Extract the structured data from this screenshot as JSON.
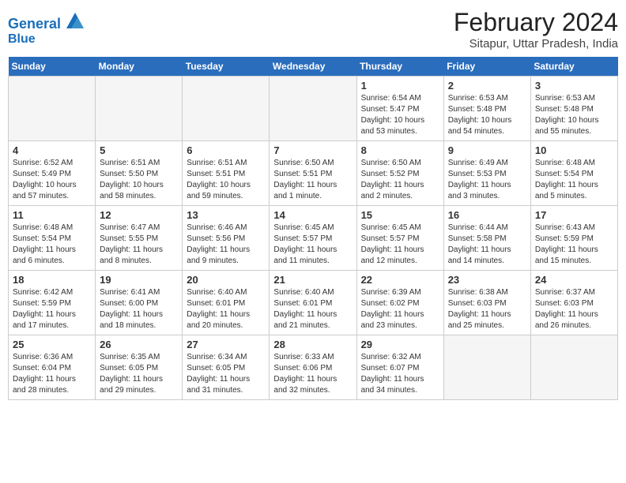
{
  "header": {
    "logo_line1": "General",
    "logo_line2": "Blue",
    "title": "February 2024",
    "subtitle": "Sitapur, Uttar Pradesh, India"
  },
  "days_of_week": [
    "Sunday",
    "Monday",
    "Tuesday",
    "Wednesday",
    "Thursday",
    "Friday",
    "Saturday"
  ],
  "weeks": [
    [
      {
        "day": "",
        "empty": true
      },
      {
        "day": "",
        "empty": true
      },
      {
        "day": "",
        "empty": true
      },
      {
        "day": "",
        "empty": true
      },
      {
        "day": "1",
        "sunrise": "6:54 AM",
        "sunset": "5:47 PM",
        "daylight": "10 hours and 53 minutes."
      },
      {
        "day": "2",
        "sunrise": "6:53 AM",
        "sunset": "5:48 PM",
        "daylight": "10 hours and 54 minutes."
      },
      {
        "day": "3",
        "sunrise": "6:53 AM",
        "sunset": "5:48 PM",
        "daylight": "10 hours and 55 minutes."
      }
    ],
    [
      {
        "day": "4",
        "sunrise": "6:52 AM",
        "sunset": "5:49 PM",
        "daylight": "10 hours and 57 minutes."
      },
      {
        "day": "5",
        "sunrise": "6:51 AM",
        "sunset": "5:50 PM",
        "daylight": "10 hours and 58 minutes."
      },
      {
        "day": "6",
        "sunrise": "6:51 AM",
        "sunset": "5:51 PM",
        "daylight": "10 hours and 59 minutes."
      },
      {
        "day": "7",
        "sunrise": "6:50 AM",
        "sunset": "5:51 PM",
        "daylight": "11 hours and 1 minute."
      },
      {
        "day": "8",
        "sunrise": "6:50 AM",
        "sunset": "5:52 PM",
        "daylight": "11 hours and 2 minutes."
      },
      {
        "day": "9",
        "sunrise": "6:49 AM",
        "sunset": "5:53 PM",
        "daylight": "11 hours and 3 minutes."
      },
      {
        "day": "10",
        "sunrise": "6:48 AM",
        "sunset": "5:54 PM",
        "daylight": "11 hours and 5 minutes."
      }
    ],
    [
      {
        "day": "11",
        "sunrise": "6:48 AM",
        "sunset": "5:54 PM",
        "daylight": "11 hours and 6 minutes."
      },
      {
        "day": "12",
        "sunrise": "6:47 AM",
        "sunset": "5:55 PM",
        "daylight": "11 hours and 8 minutes."
      },
      {
        "day": "13",
        "sunrise": "6:46 AM",
        "sunset": "5:56 PM",
        "daylight": "11 hours and 9 minutes."
      },
      {
        "day": "14",
        "sunrise": "6:45 AM",
        "sunset": "5:57 PM",
        "daylight": "11 hours and 11 minutes."
      },
      {
        "day": "15",
        "sunrise": "6:45 AM",
        "sunset": "5:57 PM",
        "daylight": "11 hours and 12 minutes."
      },
      {
        "day": "16",
        "sunrise": "6:44 AM",
        "sunset": "5:58 PM",
        "daylight": "11 hours and 14 minutes."
      },
      {
        "day": "17",
        "sunrise": "6:43 AM",
        "sunset": "5:59 PM",
        "daylight": "11 hours and 15 minutes."
      }
    ],
    [
      {
        "day": "18",
        "sunrise": "6:42 AM",
        "sunset": "5:59 PM",
        "daylight": "11 hours and 17 minutes."
      },
      {
        "day": "19",
        "sunrise": "6:41 AM",
        "sunset": "6:00 PM",
        "daylight": "11 hours and 18 minutes."
      },
      {
        "day": "20",
        "sunrise": "6:40 AM",
        "sunset": "6:01 PM",
        "daylight": "11 hours and 20 minutes."
      },
      {
        "day": "21",
        "sunrise": "6:40 AM",
        "sunset": "6:01 PM",
        "daylight": "11 hours and 21 minutes."
      },
      {
        "day": "22",
        "sunrise": "6:39 AM",
        "sunset": "6:02 PM",
        "daylight": "11 hours and 23 minutes."
      },
      {
        "day": "23",
        "sunrise": "6:38 AM",
        "sunset": "6:03 PM",
        "daylight": "11 hours and 25 minutes."
      },
      {
        "day": "24",
        "sunrise": "6:37 AM",
        "sunset": "6:03 PM",
        "daylight": "11 hours and 26 minutes."
      }
    ],
    [
      {
        "day": "25",
        "sunrise": "6:36 AM",
        "sunset": "6:04 PM",
        "daylight": "11 hours and 28 minutes."
      },
      {
        "day": "26",
        "sunrise": "6:35 AM",
        "sunset": "6:05 PM",
        "daylight": "11 hours and 29 minutes."
      },
      {
        "day": "27",
        "sunrise": "6:34 AM",
        "sunset": "6:05 PM",
        "daylight": "11 hours and 31 minutes."
      },
      {
        "day": "28",
        "sunrise": "6:33 AM",
        "sunset": "6:06 PM",
        "daylight": "11 hours and 32 minutes."
      },
      {
        "day": "29",
        "sunrise": "6:32 AM",
        "sunset": "6:07 PM",
        "daylight": "11 hours and 34 minutes."
      },
      {
        "day": "",
        "empty": true
      },
      {
        "day": "",
        "empty": true
      }
    ]
  ]
}
